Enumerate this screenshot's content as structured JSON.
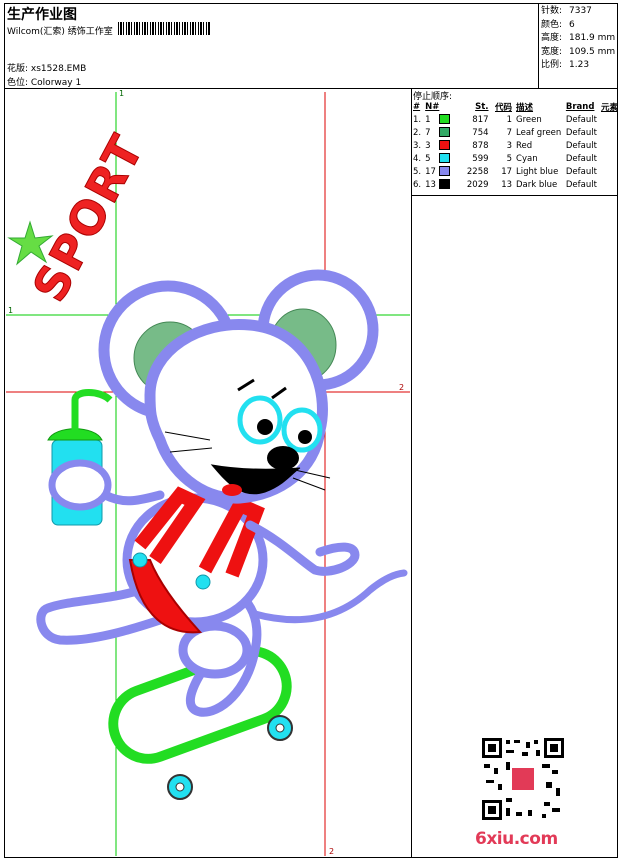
{
  "header": {
    "title": "生产作业图",
    "company": "Wilcom(汇索) 绣饰工作室",
    "design_label": "花版: xs1528.EMB",
    "colorway_label": "色位: Colorway 1"
  },
  "stats": [
    {
      "key": "针数:",
      "value": "7337"
    },
    {
      "key": "颜色:",
      "value": "6"
    },
    {
      "key": "高度:",
      "value": "181.9 mm"
    },
    {
      "key": "宽度:",
      "value": "109.5 mm"
    },
    {
      "key": "比例:",
      "value": "1.23"
    }
  ],
  "stop_sequence_title": "停止顺序:",
  "table": {
    "headers": [
      "#",
      "N#",
      "St.",
      "代码",
      "描述",
      "Brand",
      "元素"
    ],
    "rows": [
      {
        "idx": "1.",
        "n": "1",
        "color": "#22dd22",
        "st": "817",
        "code": "1",
        "desc": "Green",
        "brand": "Default"
      },
      {
        "idx": "2.",
        "n": "7",
        "color": "#33aa66",
        "st": "754",
        "code": "7",
        "desc": "Leaf green",
        "brand": "Default"
      },
      {
        "idx": "3.",
        "n": "3",
        "color": "#ee1111",
        "st": "878",
        "code": "3",
        "desc": "Red",
        "brand": "Default"
      },
      {
        "idx": "4.",
        "n": "5",
        "color": "#22e0f0",
        "st": "599",
        "code": "5",
        "desc": "Cyan",
        "brand": "Default"
      },
      {
        "idx": "5.",
        "n": "17",
        "color": "#8888ee",
        "st": "2258",
        "code": "17",
        "desc": "Light blue",
        "brand": "Default"
      },
      {
        "idx": "6.",
        "n": "13",
        "color": "#000000",
        "st": "2029",
        "code": "13",
        "desc": "Dark blue",
        "brand": "Default"
      }
    ]
  },
  "guides": {
    "green_label_top": "1",
    "green_label_left": "1",
    "red_label_right": "2",
    "red_label_bottom": "2"
  },
  "design_text": "SPORT",
  "watermark": "6xiu.com",
  "colors": {
    "green": "#22dd22",
    "leaf_green": "#33aa66",
    "red": "#ee1111",
    "cyan": "#22e0f0",
    "light_blue": "#8888ee",
    "dark": "#000000",
    "guide_green": "#00cc00",
    "guide_red": "#dd0000"
  }
}
